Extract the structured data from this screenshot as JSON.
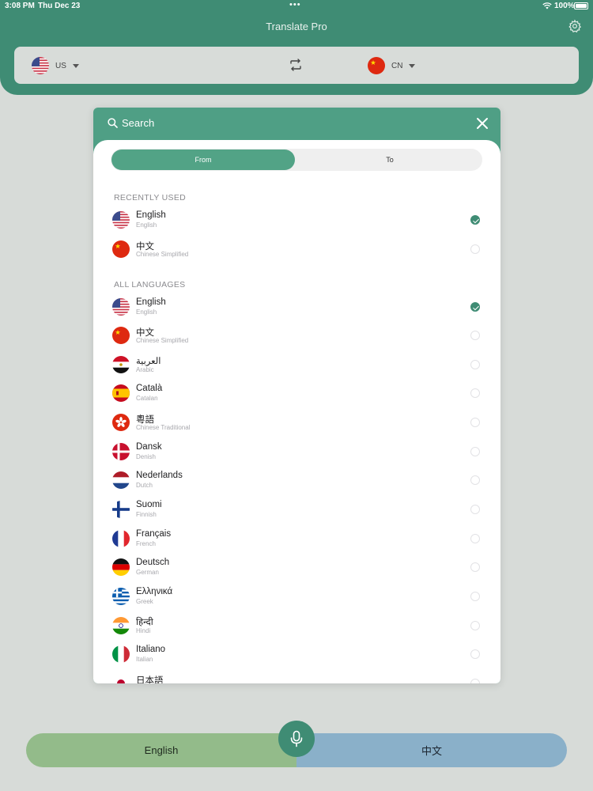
{
  "status_bar": {
    "time": "3:08 PM",
    "date": "Thu Dec 23",
    "battery": "100%"
  },
  "header": {
    "title": "Translate Pro"
  },
  "lang_bar": {
    "from_code": "US",
    "to_code": "CN"
  },
  "modal": {
    "search_label": "Search",
    "tabs": {
      "from": "From",
      "to": "To",
      "active": "From"
    },
    "recent_title": "RECENTLY USED",
    "all_title": "ALL LANGUAGES",
    "recent": [
      {
        "name": "English",
        "sub": "English",
        "flag": "us-flag",
        "checked": true
      },
      {
        "name": "中文",
        "sub": "Chinese Simplified",
        "flag": "cn-flag",
        "checked": false
      }
    ],
    "all": [
      {
        "name": "English",
        "sub": "English",
        "flag": "us-flag",
        "checked": true
      },
      {
        "name": "中文",
        "sub": "Chinese Simplified",
        "flag": "cn-flag",
        "checked": false
      },
      {
        "name": "العربية",
        "sub": "Arabic",
        "flag": "eg-flag",
        "checked": false
      },
      {
        "name": "Català",
        "sub": "Catalan",
        "flag": "es-flag",
        "checked": false
      },
      {
        "name": "粵語",
        "sub": "Chinese Traditional",
        "flag": "hk-flag",
        "checked": false
      },
      {
        "name": "Dansk",
        "sub": "Denish",
        "flag": "dk-flag",
        "checked": false
      },
      {
        "name": "Nederlands",
        "sub": "Dutch",
        "flag": "nl-flag",
        "checked": false
      },
      {
        "name": "Suomi",
        "sub": "Finnish",
        "flag": "fi-flag",
        "checked": false
      },
      {
        "name": "Français",
        "sub": "French",
        "flag": "fr-flag",
        "checked": false
      },
      {
        "name": "Deutsch",
        "sub": "German",
        "flag": "de-flag",
        "checked": false
      },
      {
        "name": "Ελληνικά",
        "sub": "Greek",
        "flag": "gr-flag",
        "checked": false
      },
      {
        "name": "हिन्दी",
        "sub": "Hindi",
        "flag": "in-flag",
        "checked": false
      },
      {
        "name": "Italiano",
        "sub": "Italian",
        "flag": "it-flag",
        "checked": false
      },
      {
        "name": "日本語",
        "sub": "",
        "flag": "jp-flag",
        "checked": false
      }
    ]
  },
  "bottom": {
    "left_label": "English",
    "right_label": "中文"
  },
  "colors": {
    "brand": "#3f8c74",
    "modal_header": "#4f9f85",
    "left_button": "#93bb8a",
    "right_button": "#8ab0c9"
  }
}
